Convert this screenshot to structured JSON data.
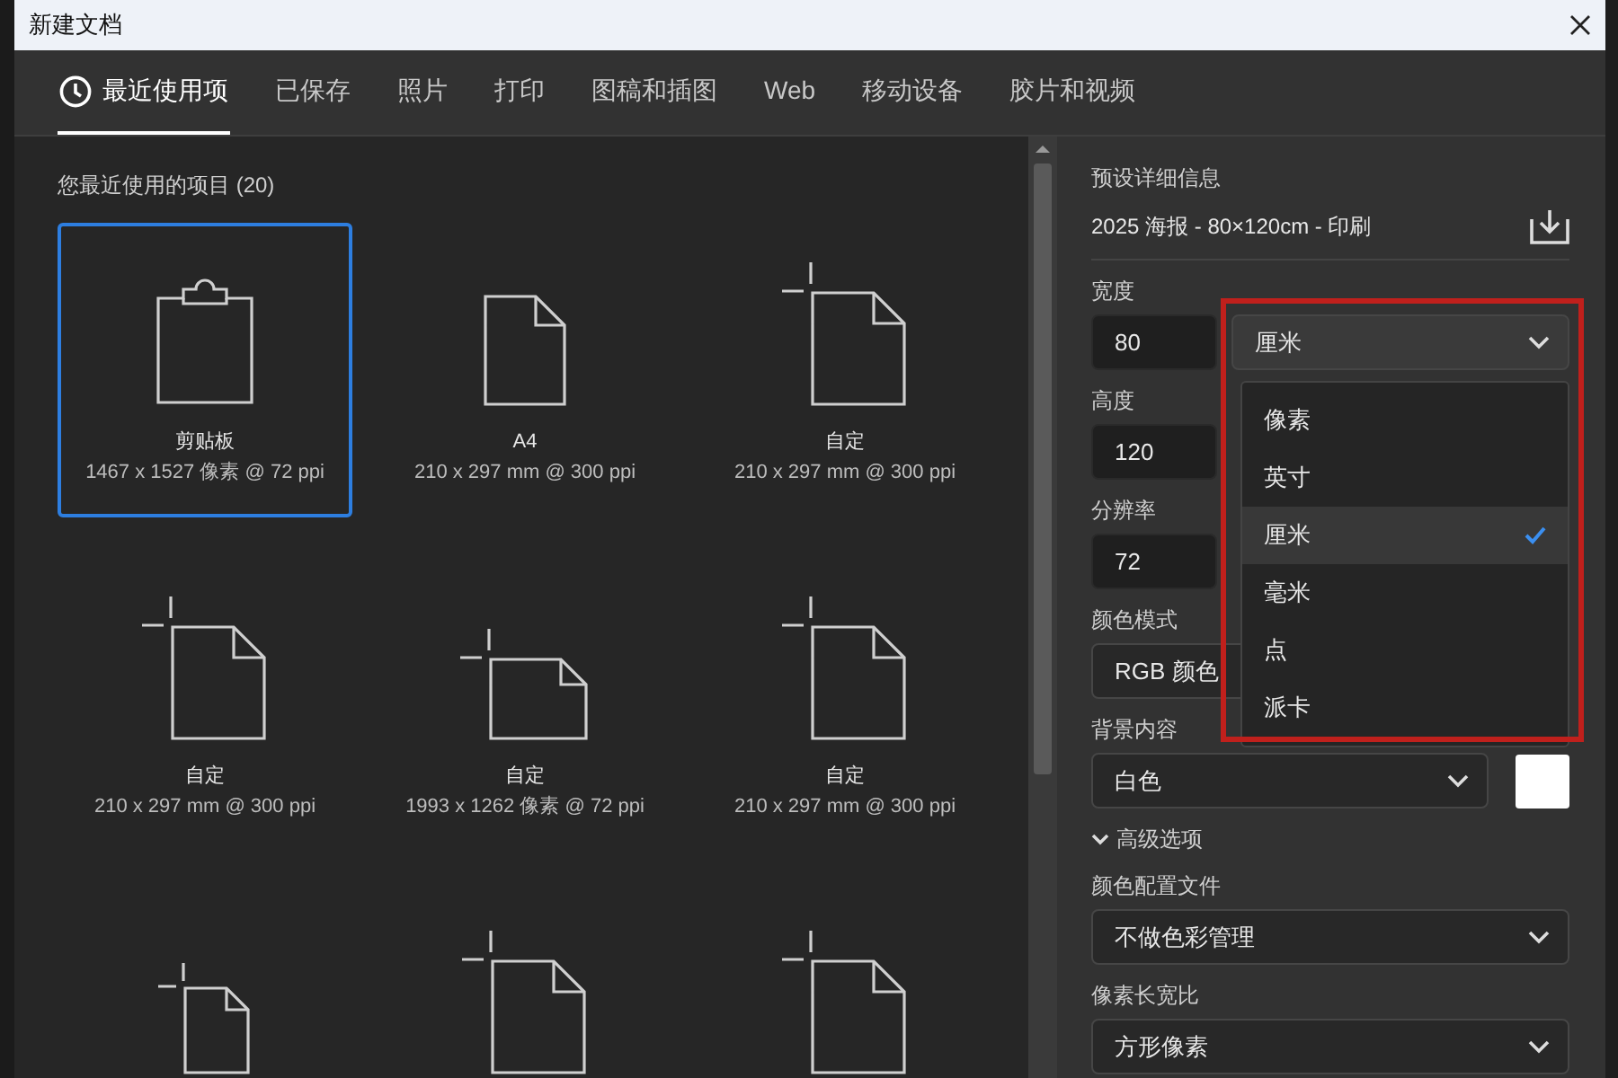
{
  "window": {
    "title": "新建文档"
  },
  "tabs": [
    {
      "label": "最近使用项",
      "selected": true,
      "kind": "recent"
    },
    {
      "label": "已保存",
      "selected": false
    },
    {
      "label": "照片",
      "selected": false
    },
    {
      "label": "打印",
      "selected": false
    },
    {
      "label": "图稿和插图",
      "selected": false
    },
    {
      "label": "Web",
      "selected": false
    },
    {
      "label": "移动设备",
      "selected": false
    },
    {
      "label": "胶片和视频",
      "selected": false
    }
  ],
  "recent": {
    "heading": "您最近使用的项目 (20)",
    "presets": [
      {
        "kind": "clipboard",
        "name": "剪贴板",
        "size": "1467 x 1527 像素 @ 72 ppi",
        "selected": true
      },
      {
        "kind": "page",
        "name": "A4",
        "size": "210 x 297 mm @ 300 ppi",
        "selected": false
      },
      {
        "kind": "custom",
        "name": "自定",
        "size": "210 x 297 mm @ 300 ppi",
        "selected": false
      },
      {
        "kind": "custom",
        "name": "自定",
        "size": "210 x 297 mm @ 300 ppi",
        "selected": false
      },
      {
        "kind": "custom-landscape",
        "name": "自定",
        "size": "1993 x 1262 像素 @ 72 ppi",
        "selected": false
      },
      {
        "kind": "custom",
        "name": "自定",
        "size": "210 x 297 mm @ 300 ppi",
        "selected": false
      },
      {
        "kind": "custom-small",
        "selected": false
      },
      {
        "kind": "custom",
        "selected": false
      },
      {
        "kind": "custom",
        "selected": false
      }
    ]
  },
  "details": {
    "heading": "预设详细信息",
    "preset_name": "2025 海报 - 80×120cm - 印刷",
    "width": {
      "label": "宽度",
      "value": "80",
      "unit": "厘米"
    },
    "unit_menu": [
      {
        "label": "像素",
        "selected": false
      },
      {
        "label": "英寸",
        "selected": false
      },
      {
        "label": "厘米",
        "selected": true
      },
      {
        "label": "毫米",
        "selected": false
      },
      {
        "label": "点",
        "selected": false
      },
      {
        "label": "派卡",
        "selected": false
      }
    ],
    "height": {
      "label": "高度",
      "value": "120"
    },
    "resolution": {
      "label": "分辨率",
      "value": "72"
    },
    "color_mode": {
      "label": "颜色模式",
      "value": "RGB 颜色"
    },
    "background": {
      "label": "背景内容",
      "value": "白色"
    },
    "advanced": {
      "label": "高级选项",
      "expanded": true
    },
    "color_profile": {
      "label": "颜色配置文件",
      "value": "不做色彩管理"
    },
    "pixel_aspect": {
      "label": "像素长宽比",
      "value": "方形像素"
    }
  }
}
